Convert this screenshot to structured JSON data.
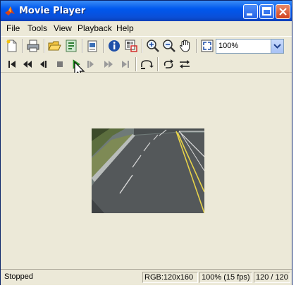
{
  "window": {
    "title": "Movie Player"
  },
  "menu": [
    "File",
    "Tools",
    "View",
    "Playback",
    "Help"
  ],
  "toolbar": {
    "zoom_value": "100%",
    "icons": [
      "new-figure-icon",
      "print-icon",
      "open-folder-icon",
      "export-icon",
      "snapshot-icon",
      "info-icon",
      "pixel-region-icon",
      "zoom-in-icon",
      "zoom-out-icon",
      "pan-hand-icon",
      "fit-window-icon"
    ]
  },
  "playback": {
    "icons": [
      "go-to-first-icon",
      "rewind-icon",
      "step-back-icon",
      "stop-icon",
      "play-icon",
      "step-forward-icon",
      "fast-forward-icon",
      "go-to-last-icon",
      "jump-to-icon",
      "loop-icon",
      "autoreverse-icon"
    ]
  },
  "status": {
    "state": "Stopped",
    "image_info": "RGB:120x160",
    "rate": "100% (15 fps)",
    "frame": "120 / 120"
  },
  "colors": {
    "title_bar": "#0058ee",
    "background": "#ece9d8",
    "play_green": "#2eae2e"
  }
}
